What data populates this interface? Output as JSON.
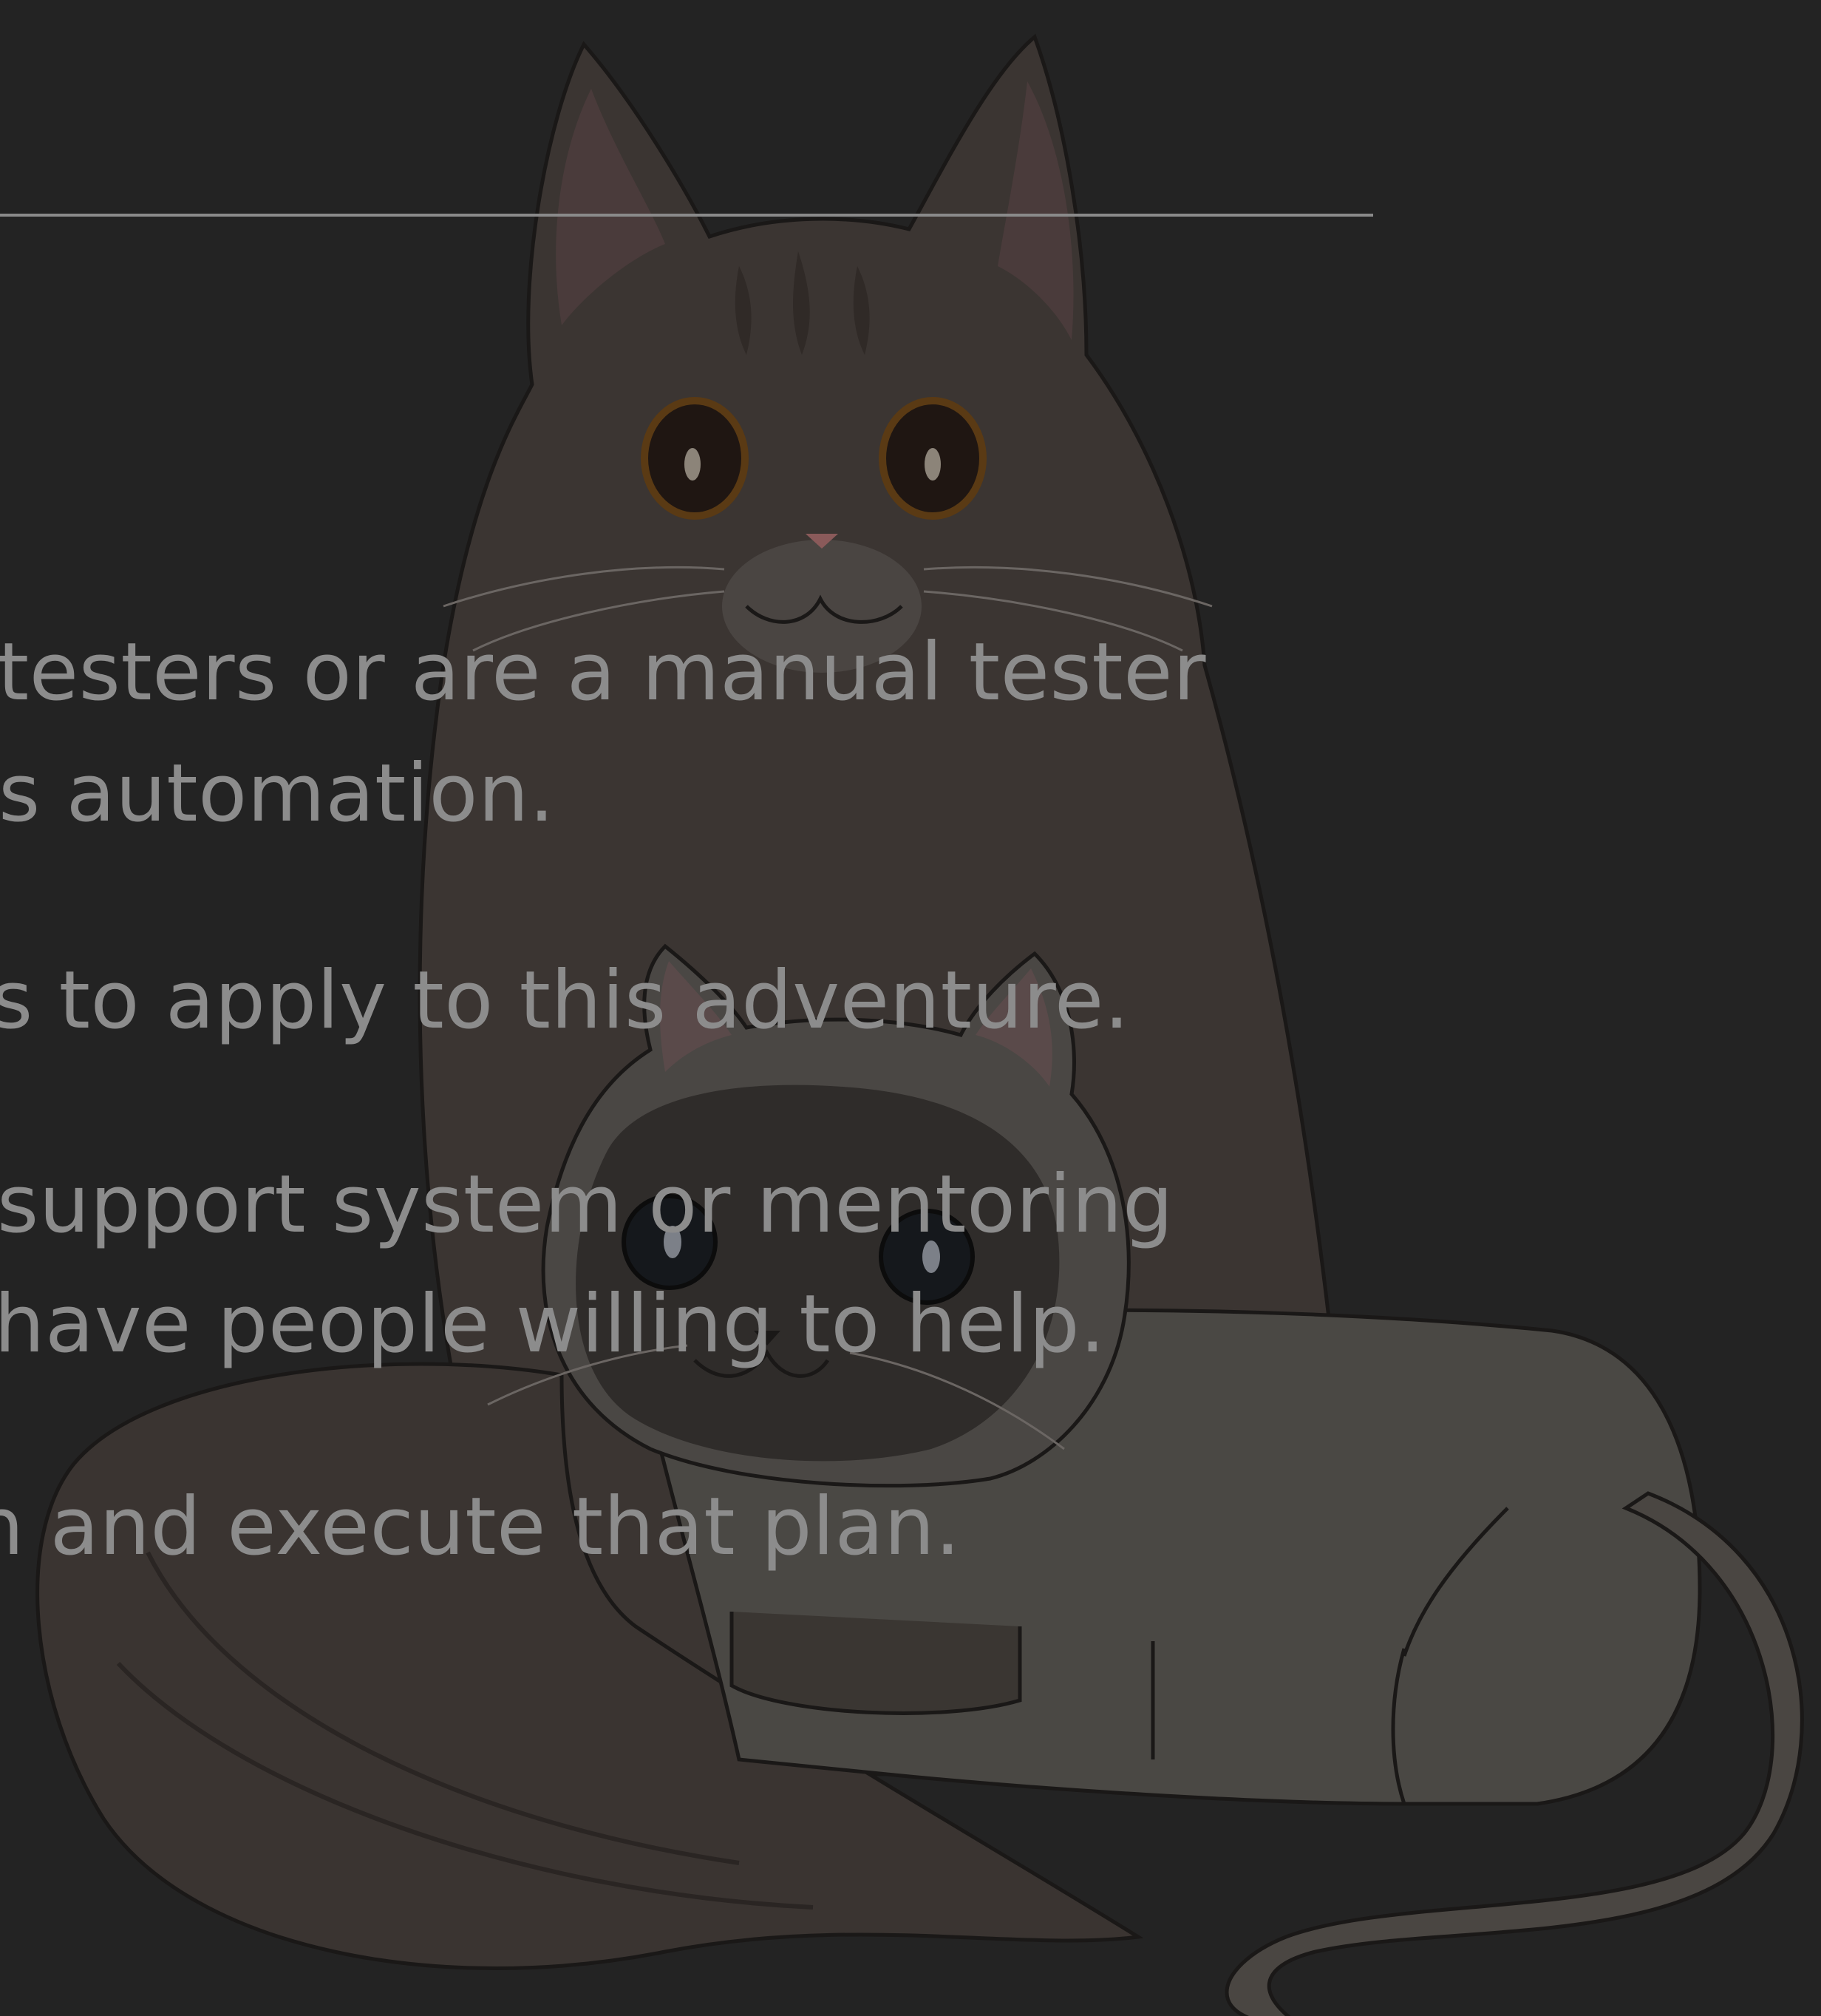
{
  "colors": {
    "background": "#232323",
    "text": "#8c8c8c",
    "rule": "#8a8a8a",
    "cat_tabby": "#3b3532",
    "cat_siamese_body": "#4a4844",
    "cat_siamese_face": "#2f2c2a"
  },
  "illustration": {
    "subject": "two-cats-illustration"
  },
  "text_lines": [
    "testers or are a manual tester",
    "s automation.",
    "s to apply to this adventure.",
    "support system or mentoring",
    "have people willing to help.",
    "n and execute that plan."
  ]
}
